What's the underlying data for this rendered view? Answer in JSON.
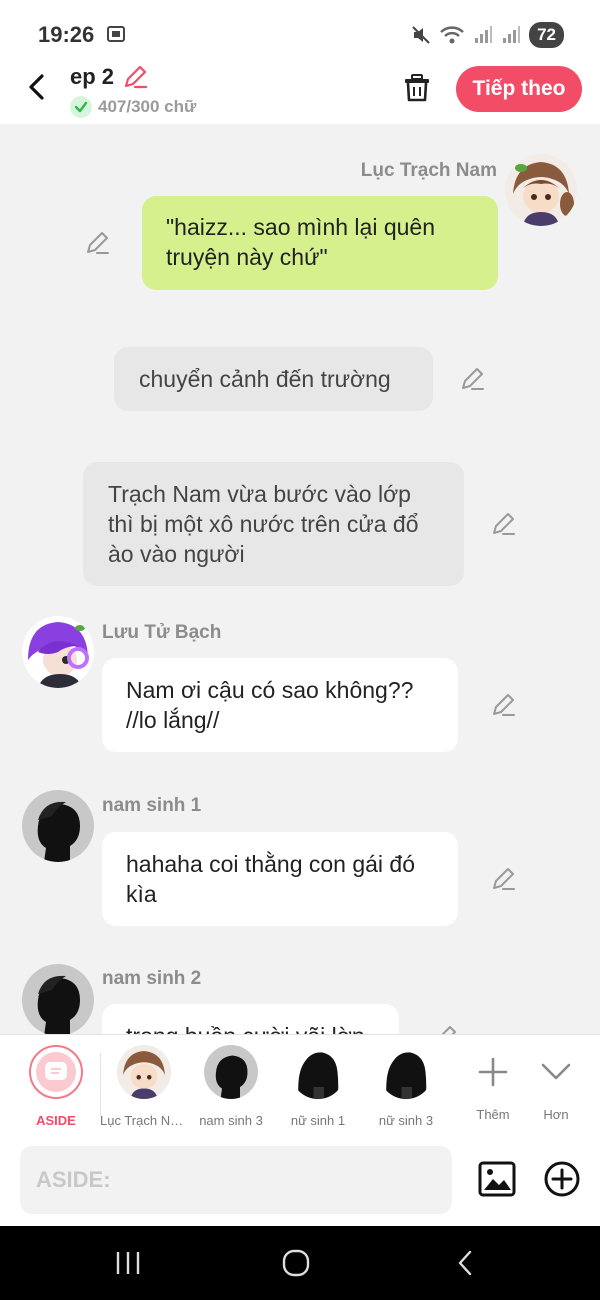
{
  "status": {
    "time": "19:26",
    "battery": "72"
  },
  "header": {
    "title": "ep 2",
    "word_count": "407/300 chữ",
    "next_label": "Tiếp theo"
  },
  "messages": [
    {
      "type": "right",
      "speaker": "Lục Trạch Nam",
      "text": "\"haizz... sao mình lại quên truyện này chứ\""
    },
    {
      "type": "aside",
      "text": "chuyển cảnh đến trường"
    },
    {
      "type": "aside",
      "text": "Trạch Nam vừa bước vào lớp thì bị một xô nước trên cửa đổ ào vào người"
    },
    {
      "type": "left",
      "speaker": "Lưu Tử Bạch",
      "text": "Nam ơi cậu có sao không?? //lo lắng//"
    },
    {
      "type": "left",
      "speaker": "nam sinh 1",
      "text": "hahaha coi thằng con gái đó kìa"
    },
    {
      "type": "left",
      "speaker": "nam sinh 2",
      "text": "trong buồn cười vãi lờn"
    }
  ],
  "characters": [
    {
      "label": "ASIDE"
    },
    {
      "label": "Lục Trạch Nam"
    },
    {
      "label": "nam sinh 3"
    },
    {
      "label": "nữ sinh 1"
    },
    {
      "label": "nữ sinh 3"
    },
    {
      "label": "Thêm"
    },
    {
      "label": "Hơn"
    }
  ],
  "input": {
    "placeholder": "ASIDE:"
  },
  "colors": {
    "accent": "#f24c67",
    "bubble_green": "#d6f08e",
    "aside_bg": "#e7e7e7"
  },
  "icons": [
    "back-arrow-icon",
    "pencil-icon",
    "check-icon",
    "trash-icon",
    "image-icon",
    "plus-circle-icon",
    "plus-icon",
    "chevron-down-icon"
  ]
}
